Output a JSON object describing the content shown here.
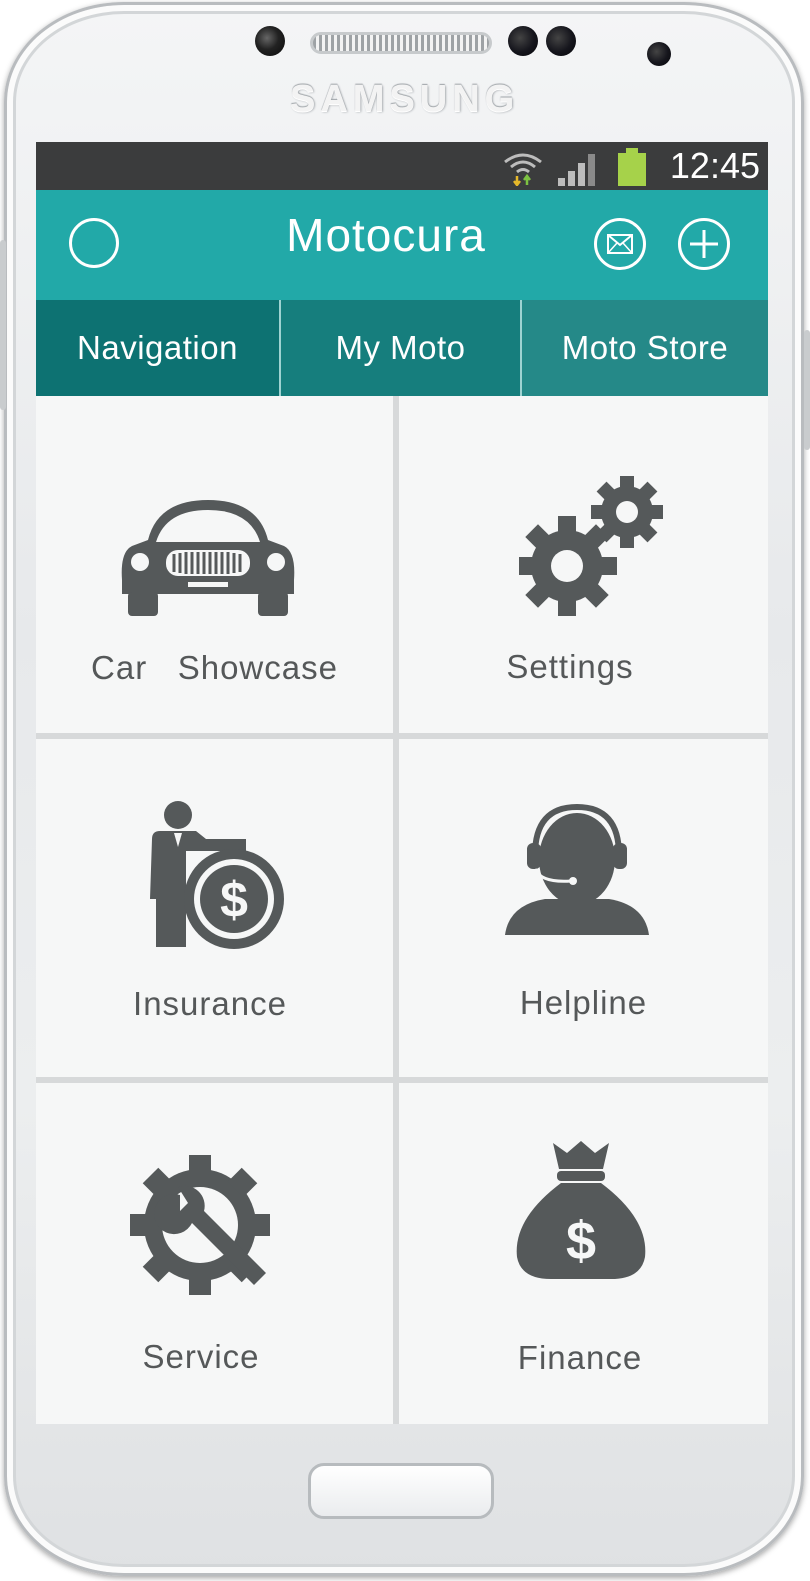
{
  "device": {
    "brand": "SAMSUNG"
  },
  "status_bar": {
    "time": "12:45",
    "battery_color": "#a6d24a"
  },
  "app_bar": {
    "title": "Motocura",
    "accent": "#22a9a8"
  },
  "tabs": [
    {
      "label": "Navigation"
    },
    {
      "label": "My Moto"
    },
    {
      "label": "Moto Store"
    }
  ],
  "menu": {
    "car_showcase": {
      "label": "Car   Showcase",
      "icon": "car-icon"
    },
    "settings": {
      "label": "Settings",
      "icon": "gears-icon"
    },
    "insurance": {
      "label": "Insurance",
      "icon": "insurance-icon"
    },
    "helpline": {
      "label": "Helpline",
      "icon": "headset-agent-icon"
    },
    "service": {
      "label": "Service",
      "icon": "wrench-gear-icon"
    },
    "finance": {
      "label": "Finance",
      "icon": "money-bag-icon"
    }
  },
  "colors": {
    "icon": "#55595a",
    "tab_dark": "#0d7272",
    "status_bar": "#3b3c3d"
  }
}
